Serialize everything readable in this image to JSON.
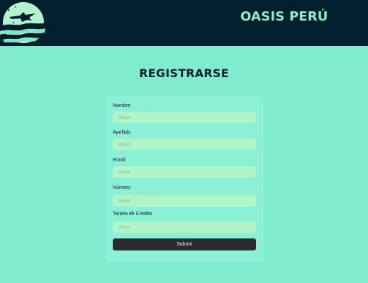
{
  "header": {
    "brand": "OASIS PERÚ"
  },
  "page": {
    "title": "REGISTRARSE"
  },
  "form": {
    "fields": [
      {
        "label": "Nombre",
        "placeholder": "Value",
        "value": ""
      },
      {
        "label": "Apellido",
        "placeholder": "Value",
        "value": ""
      },
      {
        "label": "Email",
        "placeholder": "Value",
        "value": ""
      },
      {
        "label": "Número",
        "placeholder": "Value",
        "value": ""
      },
      {
        "label": "Tarjeta de Crédito",
        "placeholder": "Value",
        "value": ""
      }
    ],
    "submit_label": "Submit"
  },
  "colors": {
    "header_bg": "#021f2d",
    "page_bg": "#81ebcd",
    "card_bg": "#8cf0d6",
    "input_bg": "#b0f5c8",
    "brand_text": "#8cf0c6",
    "button_bg": "#2c2c2c"
  },
  "icons": {
    "logo": "oasis-logo-icon"
  }
}
